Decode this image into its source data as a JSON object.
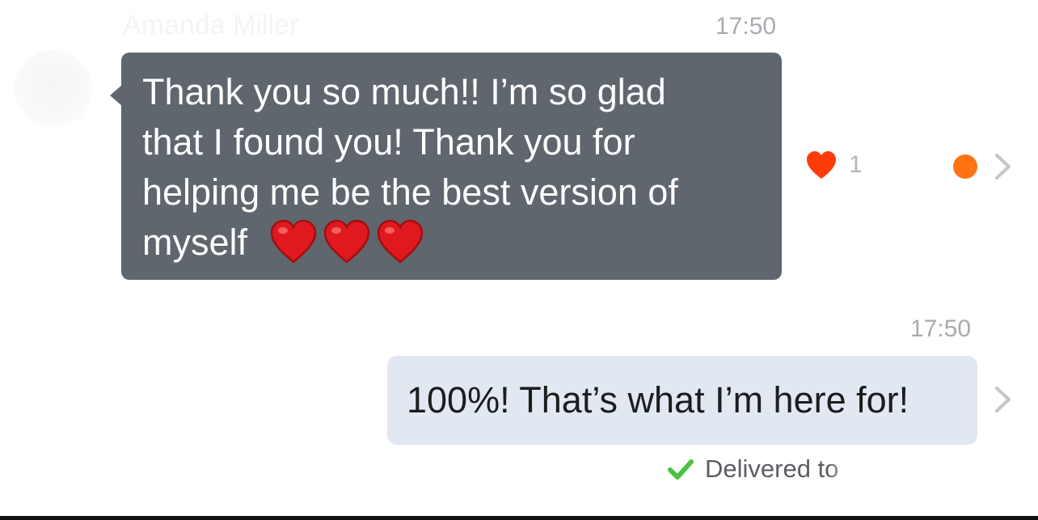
{
  "conversation": {
    "incoming": {
      "sender_name": "Amanda Miller",
      "timestamp": "17:50",
      "lines": [
        "Thank you so much!! I’m so glad",
        "that I found you! Thank you for",
        "helping me be the best version of",
        "myself"
      ],
      "emoji": [
        "red-heart-emoji",
        "red-heart-emoji",
        "red-heart-emoji"
      ],
      "bubble_color": "#5f666d",
      "reaction": {
        "icon": "heart-icon",
        "count": "1",
        "color": "#ff3b0a"
      },
      "status_dot_color": "#ff7314"
    },
    "outgoing": {
      "timestamp": "17:50",
      "text": "100%! That’s what I’m here for!",
      "bubble_color": "#e2e8f1",
      "status": {
        "icon": "check-icon",
        "text": "Delivered to",
        "color": "#4cc242"
      }
    }
  },
  "icons": {
    "chevron": "chevron-right-icon"
  }
}
